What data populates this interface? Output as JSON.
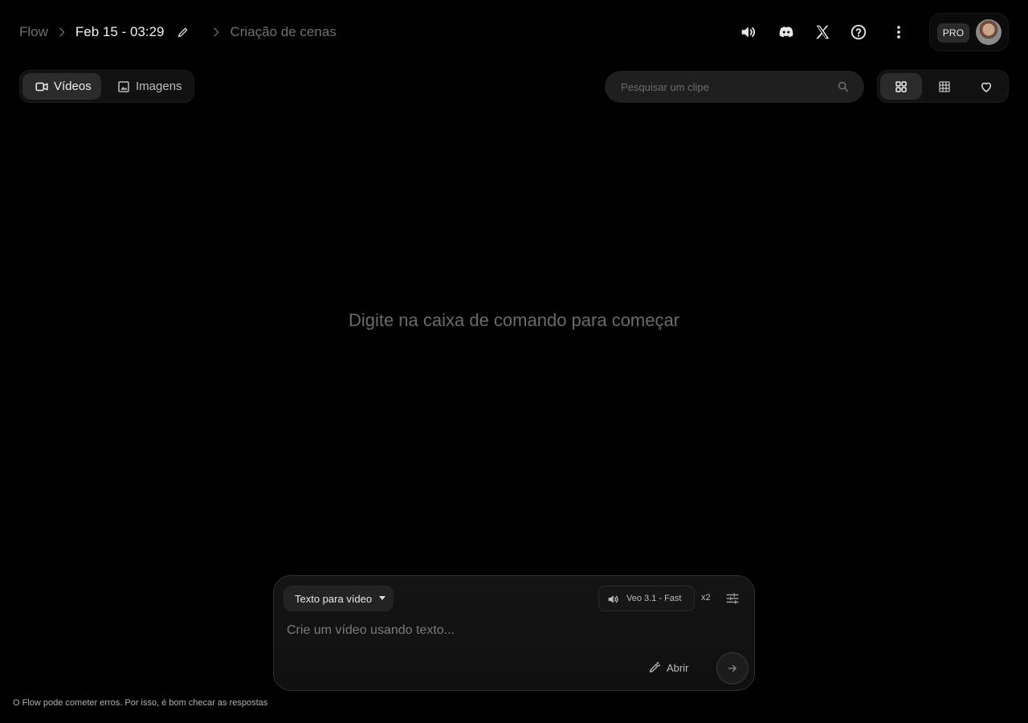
{
  "breadcrumb": {
    "root": "Flow",
    "project": "Feb 15 - 03:29",
    "section": "Criação de cenas"
  },
  "header": {
    "icons": [
      "speaker-icon",
      "discord-icon",
      "x-icon",
      "help-icon",
      "more-vert-icon"
    ],
    "plan_badge": "PRO"
  },
  "tabs": [
    {
      "label": "Vídeos",
      "icon": "videocam-icon",
      "active": true
    },
    {
      "label": "Imagens",
      "icon": "image-icon",
      "active": false
    }
  ],
  "search": {
    "placeholder": "Pesquisar um clipe"
  },
  "views": [
    {
      "icon": "grid-large-icon",
      "active": true
    },
    {
      "icon": "grid-small-icon",
      "active": false
    },
    {
      "icon": "heart-icon",
      "active": false
    }
  ],
  "empty_state": {
    "message": "Digite na caixa de comando para começar"
  },
  "composer": {
    "mode_label": "Texto para vídeo",
    "model_label": "Veo 3.1 - Fast",
    "count_label": "x2",
    "placeholder": "Crie um vídeo usando texto...",
    "open_label": "Abrir"
  },
  "footer": {
    "disclaimer": "O Flow pode cometer erros. Por isso, é bom checar as respostas"
  },
  "colors": {
    "background": "#000000",
    "panel": "#111111",
    "active_tab": "#2b2b2b"
  }
}
